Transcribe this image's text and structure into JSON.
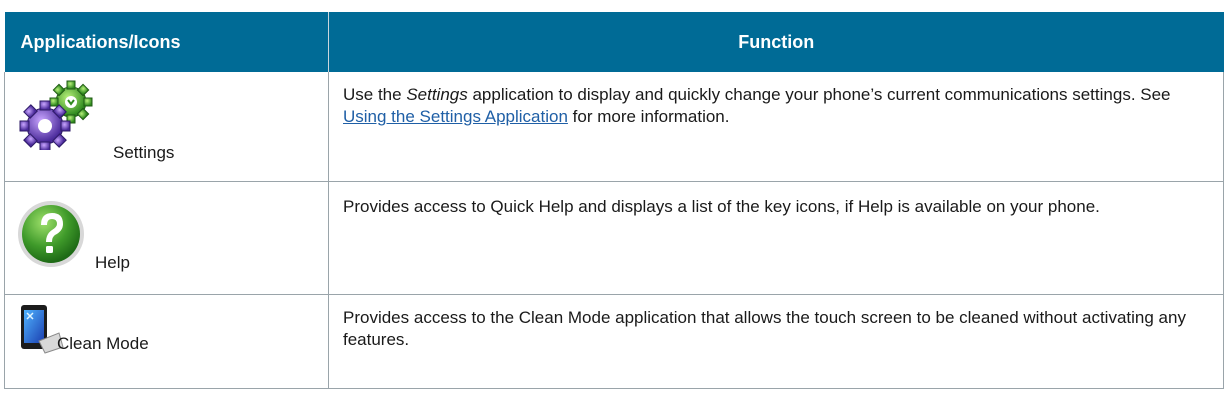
{
  "table": {
    "headers": {
      "app": "Applications/Icons",
      "function": "Function"
    },
    "rows": [
      {
        "app_label": "Settings",
        "icon": "settings-gears-icon",
        "desc_italic": "Settings",
        "desc_prefix": "Use the ",
        "desc_mid": " application to display and quickly change your phone’s current communications settings. See ",
        "link": "Using the Settings Application",
        "desc_suffix": " for more information."
      },
      {
        "app_label": "Help",
        "icon": "help-question-icon",
        "desc": "Provides access to Quick Help and displays a list of the key icons, if Help is available on your phone."
      },
      {
        "app_label": "Clean Mode",
        "icon": "clean-mode-phone-icon",
        "desc": "Provides access to the Clean Mode application that allows the touch screen to be cleaned without activating any features."
      }
    ]
  },
  "colors": {
    "header_bg": "#006b96",
    "link": "#1f5fa6"
  }
}
